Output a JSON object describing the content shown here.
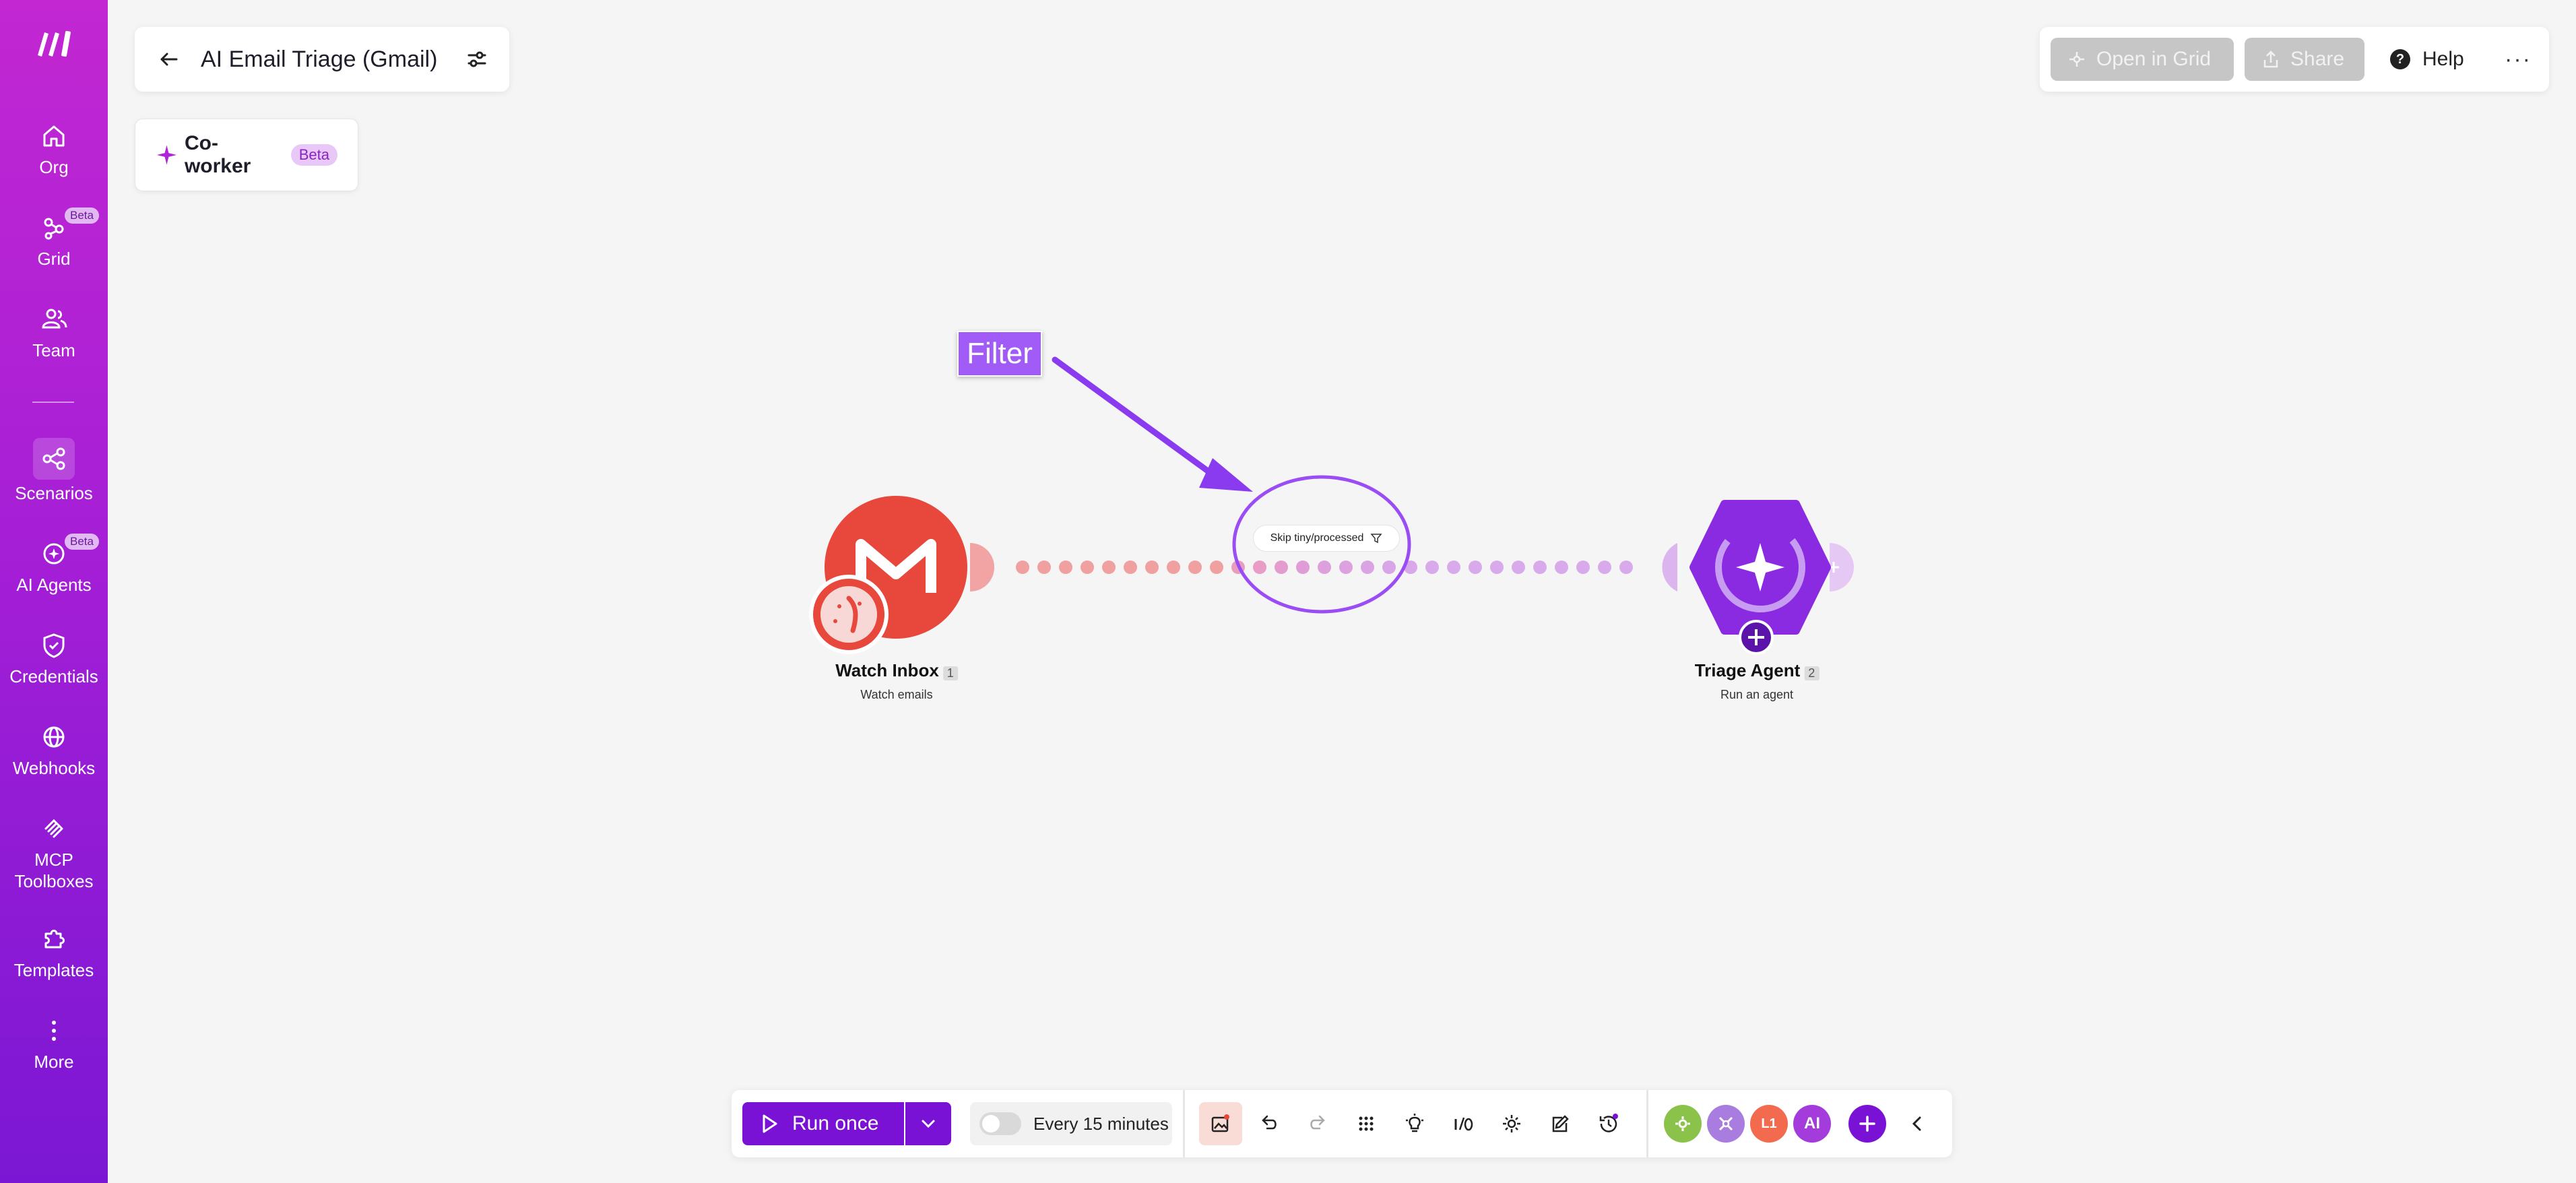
{
  "sidebar": {
    "items": [
      {
        "label": "Org",
        "icon": "home-icon"
      },
      {
        "label": "Grid",
        "icon": "grid-icon",
        "badge": "Beta"
      },
      {
        "label": "Team",
        "icon": "team-icon"
      },
      {
        "label": "Scenarios",
        "icon": "scenarios-icon",
        "active": true
      },
      {
        "label": "AI Agents",
        "icon": "ai-agents-icon",
        "badge": "Beta"
      },
      {
        "label": "Credentials",
        "icon": "shield-icon"
      },
      {
        "label": "Webhooks",
        "icon": "globe-icon"
      },
      {
        "label": "MCP Toolboxes",
        "icon": "mcp-icon"
      },
      {
        "label": "Templates",
        "icon": "puzzle-icon"
      },
      {
        "label": "More",
        "icon": "more-vertical-icon"
      }
    ]
  },
  "header": {
    "title": "AI Email Triage (Gmail)"
  },
  "coworker": {
    "label": "Co-worker",
    "badge": "Beta"
  },
  "top_actions": {
    "open_grid": "Open in Grid",
    "share": "Share",
    "help": "Help",
    "more": "···"
  },
  "scenario": {
    "annotation": "Filter",
    "filter_label": "Skip tiny/processed",
    "modules": [
      {
        "name": "Watch Inbox",
        "index": "1",
        "subtitle": "Watch emails",
        "icon": "gmail-icon",
        "color": "#e8473c"
      },
      {
        "name": "Triage Agent",
        "index": "2",
        "subtitle": "Run an agent",
        "icon": "ai-agent-icon",
        "color": "#8a2be2"
      }
    ],
    "colors": {
      "gmail": "#e8473c",
      "agent": "#8a2be2",
      "annotation": "#a15cf7"
    }
  },
  "toolbar": {
    "run_once": "Run once",
    "schedule": "Every 15 minutes",
    "schedule_enabled": false,
    "ai_label": "AI",
    "l1_label": "L1"
  }
}
